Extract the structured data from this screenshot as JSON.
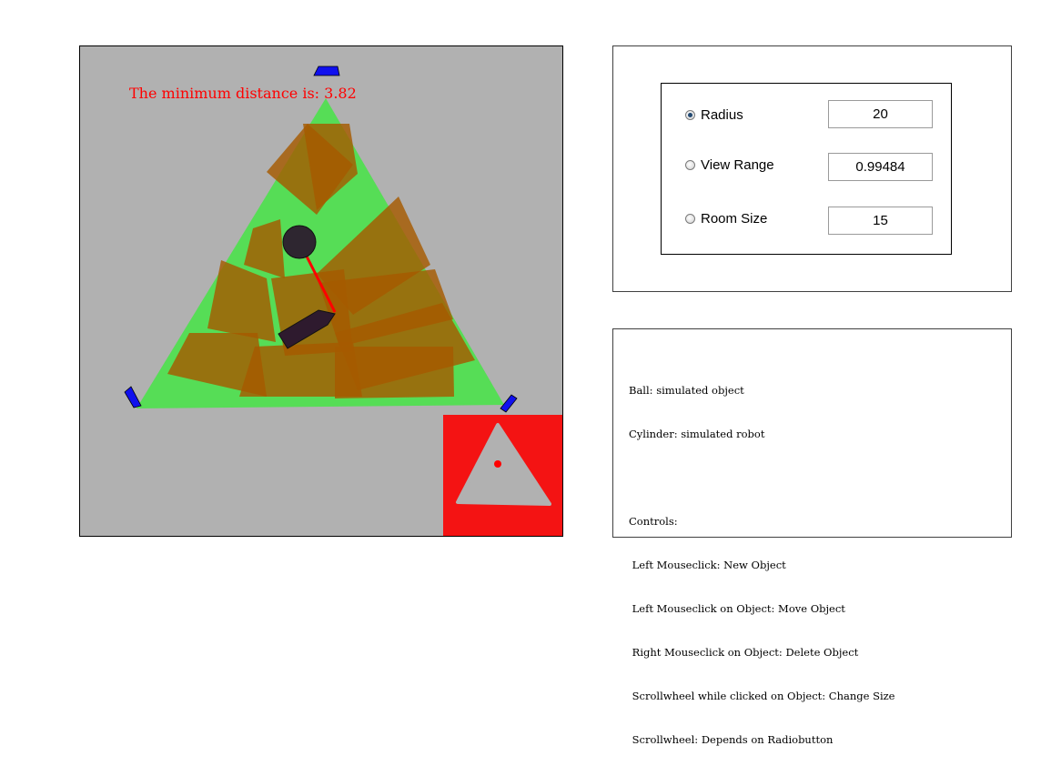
{
  "simulation": {
    "min_distance_text": "The minimum distance is: 3.82",
    "colors": {
      "background": "#b1b1b1",
      "view_range": "#56dd56",
      "sensor_cones": "#a65a00",
      "ball": "#2e2630",
      "robot": "#2e1a2e",
      "distance_line": "#ff0000",
      "sensors": "#1010ee",
      "inset_background": "#f41313",
      "inset_room": "#b1b1b1",
      "inset_marker": "#ff0000"
    },
    "icons": {
      "ball": "ball-object",
      "robot": "cylinder-robot",
      "sensor": "sensor-marker"
    }
  },
  "controls": {
    "options": [
      {
        "label": "Radius",
        "value": "20",
        "checked": true
      },
      {
        "label": "View Range",
        "value": "0.99484",
        "checked": false
      },
      {
        "label": "Room Size",
        "value": "15",
        "checked": false
      }
    ]
  },
  "info": {
    "lines": [
      "Ball: simulated object",
      "Cylinder: simulated robot",
      "",
      "Controls:",
      " Left Mouseclick: New Object",
      " Left Mouseclick on Object: Move Object",
      " Right Mouseclick on Object: Delete Object",
      " Scrollwheel while clicked on Object: Change Size",
      " Scrollwheel: Depends on Radiobutton"
    ]
  }
}
